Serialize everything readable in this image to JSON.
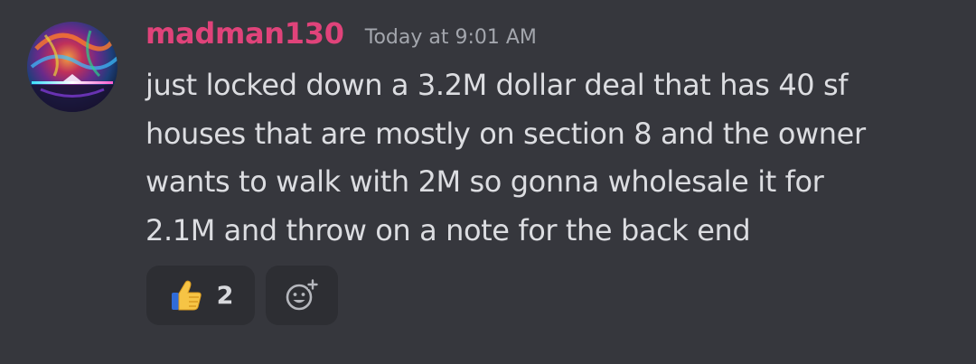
{
  "message": {
    "author": {
      "username": "madman130",
      "name_color": "#e0437a"
    },
    "timestamp": "Today at 9:01 AM",
    "lines": [
      "just locked down a 3.2M dollar deal that has 40 sf",
      "houses that are mostly on section 8 and the owner",
      "wants to walk with 2M so gonna wholesale it for",
      "2.1M and throw on a note for the back end"
    ],
    "reactions": [
      {
        "emoji": "thumbs-up-emoji",
        "count": "2"
      }
    ],
    "add_reaction_icon": "add-reaction-icon"
  },
  "colors": {
    "background": "#36373d",
    "reaction_bg": "#2d2e33",
    "text": "#dcdde1",
    "timestamp": "#a3a6ad"
  }
}
